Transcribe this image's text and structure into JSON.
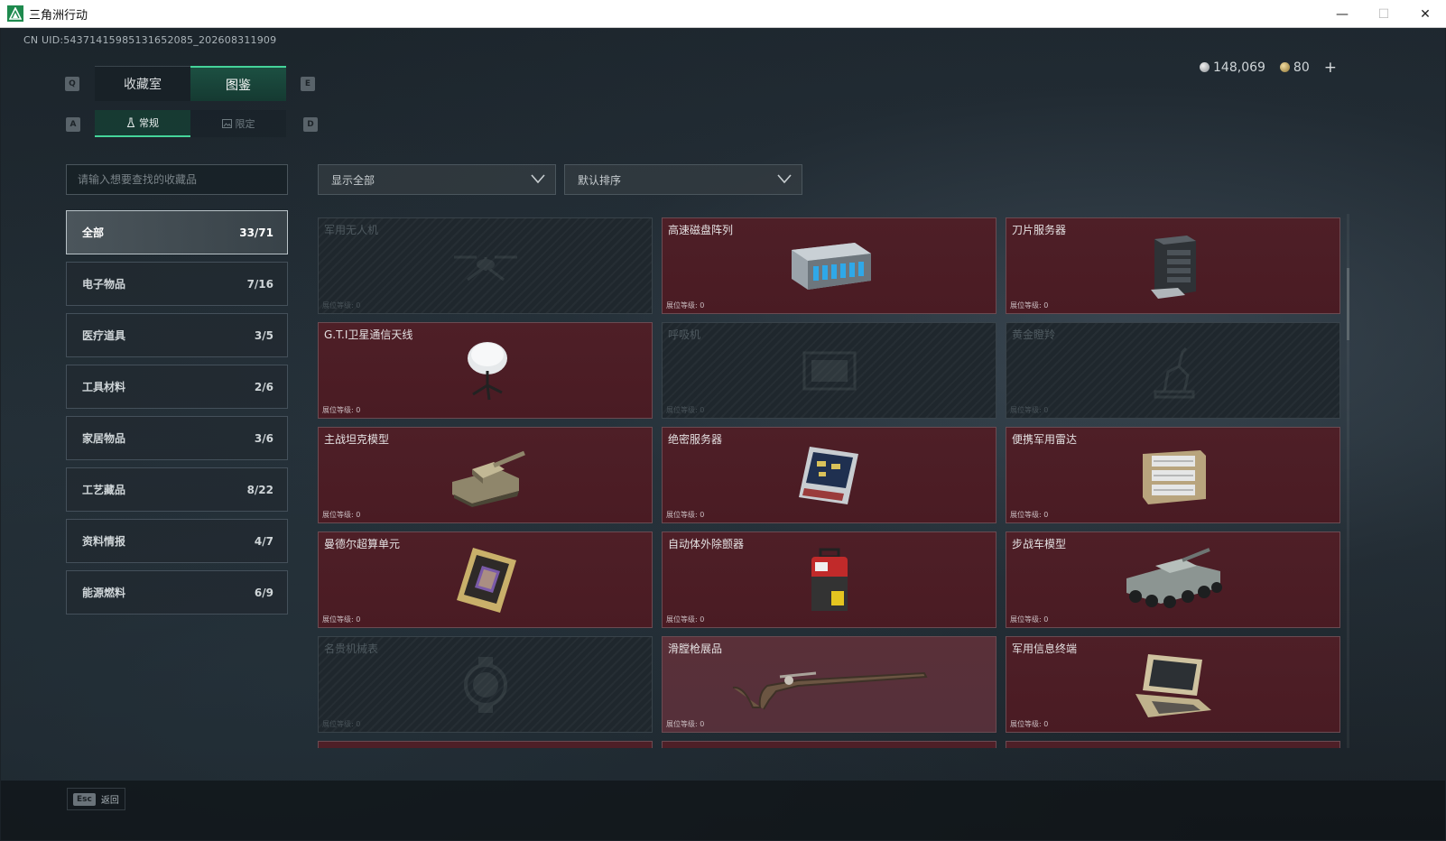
{
  "window": {
    "title": "三角洲行动",
    "minimize": "—",
    "maximize": "☐",
    "close": "✕"
  },
  "uid": "CN UID:54371415985131652085_202608311909",
  "currency": {
    "silver": "148,069",
    "gold": "80",
    "add": "+"
  },
  "keys": {
    "prev_tab": "Q",
    "next_tab": "E",
    "prev_sub": "A",
    "next_sub": "D"
  },
  "tabs": [
    {
      "label": "收藏室"
    },
    {
      "label": "图鉴"
    }
  ],
  "subtabs": [
    {
      "label": "常规"
    },
    {
      "label": "限定"
    }
  ],
  "search": {
    "placeholder": "请输入想要查找的收藏品"
  },
  "filters": {
    "display": "显示全部",
    "sort": "默认排序"
  },
  "categories": [
    {
      "label": "全部",
      "count": "33/71"
    },
    {
      "label": "电子物品",
      "count": "7/16"
    },
    {
      "label": "医疗道具",
      "count": "3/5"
    },
    {
      "label": "工具材料",
      "count": "2/6"
    },
    {
      "label": "家居物品",
      "count": "3/6"
    },
    {
      "label": "工艺藏品",
      "count": "8/22"
    },
    {
      "label": "资料情报",
      "count": "4/7"
    },
    {
      "label": "能源燃料",
      "count": "6/9"
    }
  ],
  "items": [
    {
      "name": "军用无人机",
      "level": "展位等级: 0",
      "icon": "drone-icon"
    },
    {
      "name": "高速磁盘阵列",
      "level": "展位等级: 0",
      "icon": "disk-array-icon"
    },
    {
      "name": "刀片服务器",
      "level": "展位等级: 0",
      "icon": "blade-server-icon"
    },
    {
      "name": "G.T.I卫星通信天线",
      "level": "展位等级: 0",
      "icon": "satellite-antenna-icon"
    },
    {
      "name": "呼吸机",
      "level": "展位等级: 0",
      "icon": "ventilator-icon"
    },
    {
      "name": "黄金瞪羚",
      "level": "展位等级: 0",
      "icon": "gazelle-statue-icon"
    },
    {
      "name": "主战坦克模型",
      "level": "展位等级: 0",
      "icon": "tank-model-icon"
    },
    {
      "name": "绝密服务器",
      "level": "展位等级: 0",
      "icon": "server-icon"
    },
    {
      "name": "便携军用雷达",
      "level": "展位等级: 0",
      "icon": "radar-icon"
    },
    {
      "name": "曼德尔超算单元",
      "level": "展位等级: 0",
      "icon": "cpu-unit-icon"
    },
    {
      "name": "自动体外除颤器",
      "level": "展位等级: 0",
      "icon": "defibrillator-icon"
    },
    {
      "name": "步战车模型",
      "level": "展位等级: 0",
      "icon": "ifv-model-icon"
    },
    {
      "name": "名贵机械表",
      "level": "展位等级: 0",
      "icon": "watch-icon"
    },
    {
      "name": "滑膛枪展品",
      "level": "展位等级: 0",
      "icon": "musket-icon"
    },
    {
      "name": "军用信息终端",
      "level": "展位等级: 0",
      "icon": "terminal-icon"
    }
  ],
  "footer": {
    "esc_key": "Esc",
    "esc_label": "返回"
  }
}
